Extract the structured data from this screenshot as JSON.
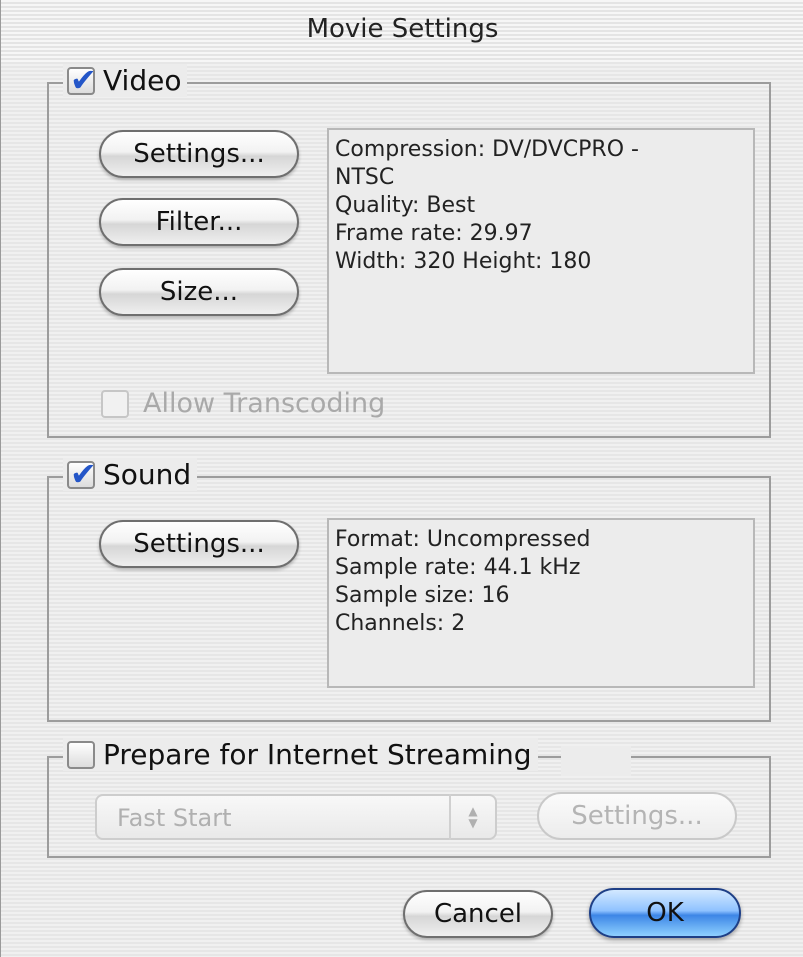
{
  "window": {
    "title": "Movie Settings"
  },
  "video": {
    "label": "Video",
    "checked": true,
    "buttons": {
      "settings": "Settings...",
      "filter": "Filter...",
      "size": "Size..."
    },
    "info": [
      "Compression: DV/DVCPRO -",
      "NTSC",
      "Quality: Best",
      "Frame rate: 29.97",
      "Width: 320 Height: 180"
    ],
    "allow_transcoding": {
      "label": "Allow Transcoding",
      "checked": false,
      "enabled": false
    }
  },
  "sound": {
    "label": "Sound",
    "checked": true,
    "buttons": {
      "settings": "Settings..."
    },
    "info": [
      "Format: Uncompressed",
      "Sample rate: 44.1 kHz",
      "Sample size: 16",
      "Channels: 2"
    ]
  },
  "streaming": {
    "label": "Prepare for Internet Streaming",
    "checked": false,
    "select": {
      "value": "Fast Start",
      "enabled": false
    },
    "settings_button": "Settings...",
    "settings_enabled": false
  },
  "footer": {
    "cancel": "Cancel",
    "ok": "OK"
  },
  "colors": {
    "ok_button": "#3d86e6",
    "checkmark": "#2456c8"
  }
}
